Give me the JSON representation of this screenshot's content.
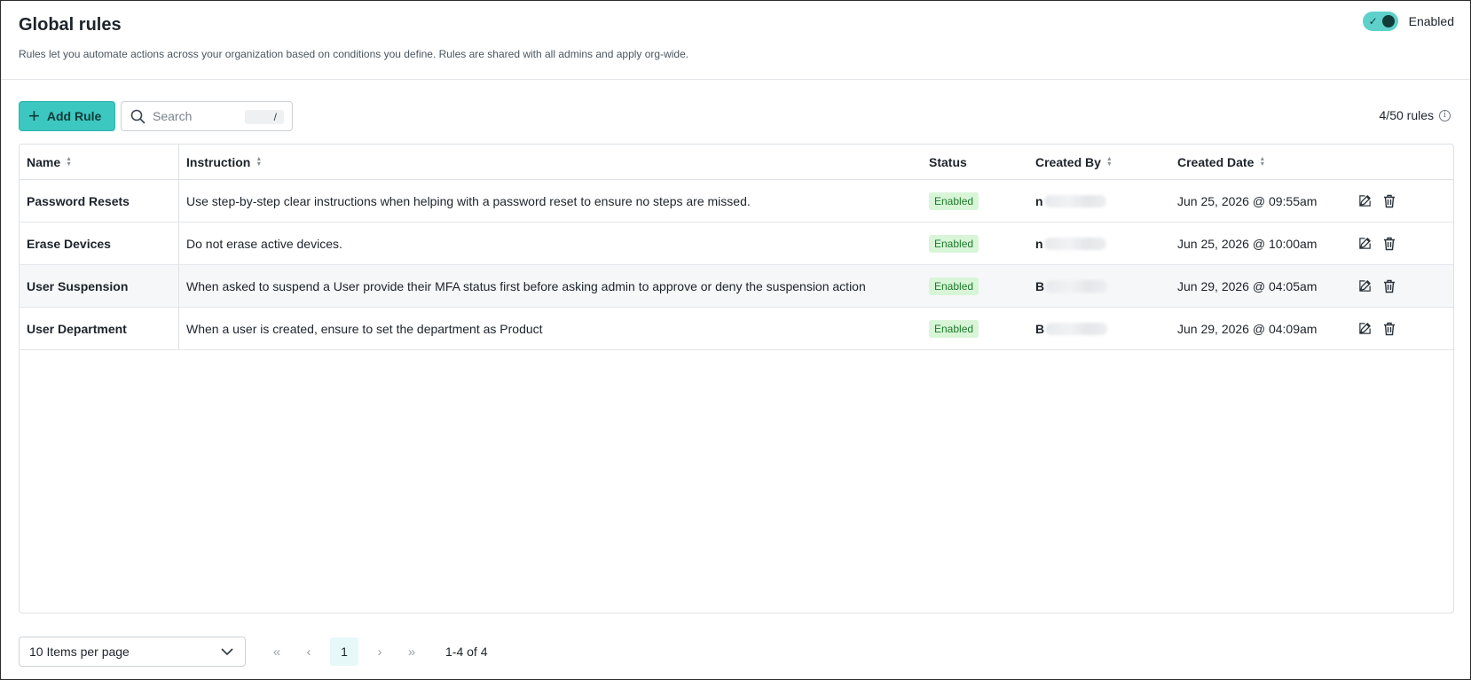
{
  "header": {
    "title": "Global rules",
    "description": "Rules let you automate actions across your organization based on conditions you define. Rules are shared with all admins and apply org-wide.",
    "toggle_label": "Enabled",
    "toggle_on": true
  },
  "toolbar": {
    "add_rule_label": "Add Rule",
    "search_placeholder": "Search",
    "search_value": "",
    "search_shortcut": "/",
    "rule_count": "4/50 rules"
  },
  "table": {
    "columns": [
      "Name",
      "Instruction",
      "Status",
      "Created By",
      "Created Date"
    ],
    "rows": [
      {
        "name": "Password Resets",
        "instruction": "Use step-by-step clear instructions when helping with a password reset to ensure no steps are missed.",
        "status": "Enabled",
        "created_by": "n",
        "created_date": "Jun 25, 2026 @ 09:55am"
      },
      {
        "name": "Erase Devices",
        "instruction": "Do not erase active devices.",
        "status": "Enabled",
        "created_by": "n",
        "created_date": "Jun 25, 2026 @ 10:00am"
      },
      {
        "name": "User Suspension",
        "instruction": "When asked to suspend a User provide their MFA status first before asking admin to approve or deny the suspension action",
        "status": "Enabled",
        "created_by": "B",
        "created_date": "Jun 29, 2026 @ 04:05am"
      },
      {
        "name": "User Department",
        "instruction": "When a user is created, ensure to set the department as Product",
        "status": "Enabled",
        "created_by": "B",
        "created_date": "Jun 29, 2026 @ 04:09am"
      }
    ]
  },
  "pagination": {
    "per_page": "10 Items per page",
    "current_page": "1",
    "range": "1-4 of 4"
  },
  "colors": {
    "accent": "#3cc7c0",
    "toggle": "#5ed1cb",
    "badge_bg": "#d8f5d8",
    "badge_text": "#1c7a2a",
    "current_page_bg": "#e6f8f7"
  },
  "icons": [
    "check-icon",
    "plus-icon",
    "search-icon",
    "info-icon",
    "sort-icon",
    "edit-icon",
    "trash-icon",
    "chevron-down-icon",
    "first-page-icon",
    "prev-page-icon",
    "next-page-icon",
    "last-page-icon"
  ]
}
